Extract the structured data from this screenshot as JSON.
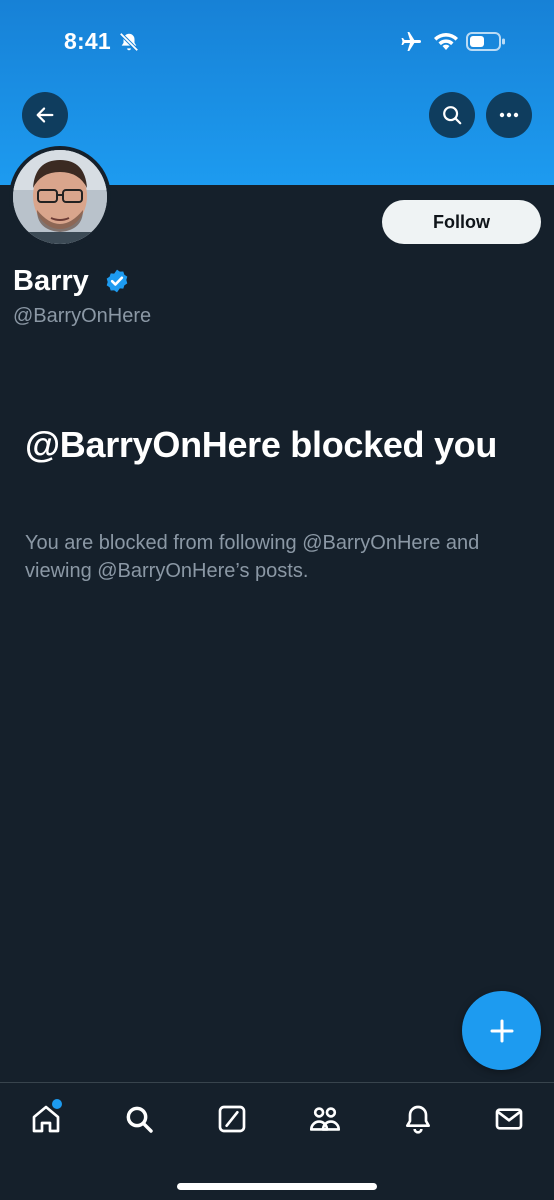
{
  "status_bar": {
    "time": "8:41",
    "icons": [
      "bell-muted-icon",
      "airplane-icon",
      "wifi-icon",
      "battery-icon"
    ]
  },
  "header": {
    "back_icon": "arrow-left-icon",
    "search_icon": "search-icon",
    "more_icon": "more-horizontal-icon"
  },
  "profile": {
    "display_name": "Barry",
    "verified": true,
    "handle": "@BarryOnHere",
    "follow_label": "Follow"
  },
  "blocked": {
    "title": "@BarryOnHere blocked you",
    "description": "You are blocked from following @BarryOnHere and viewing @BarryOnHere’s posts."
  },
  "fab": {
    "icon": "plus-icon"
  },
  "bottom_nav": {
    "items": [
      {
        "icon": "home-icon",
        "has_notification_dot": true
      },
      {
        "icon": "search-icon"
      },
      {
        "icon": "grok-icon"
      },
      {
        "icon": "communities-icon"
      },
      {
        "icon": "notifications-bell-icon"
      },
      {
        "icon": "messages-envelope-icon"
      }
    ]
  },
  "colors": {
    "background": "#15202b",
    "accent": "#1d9bf0",
    "secondary_text": "#8b98a5"
  }
}
